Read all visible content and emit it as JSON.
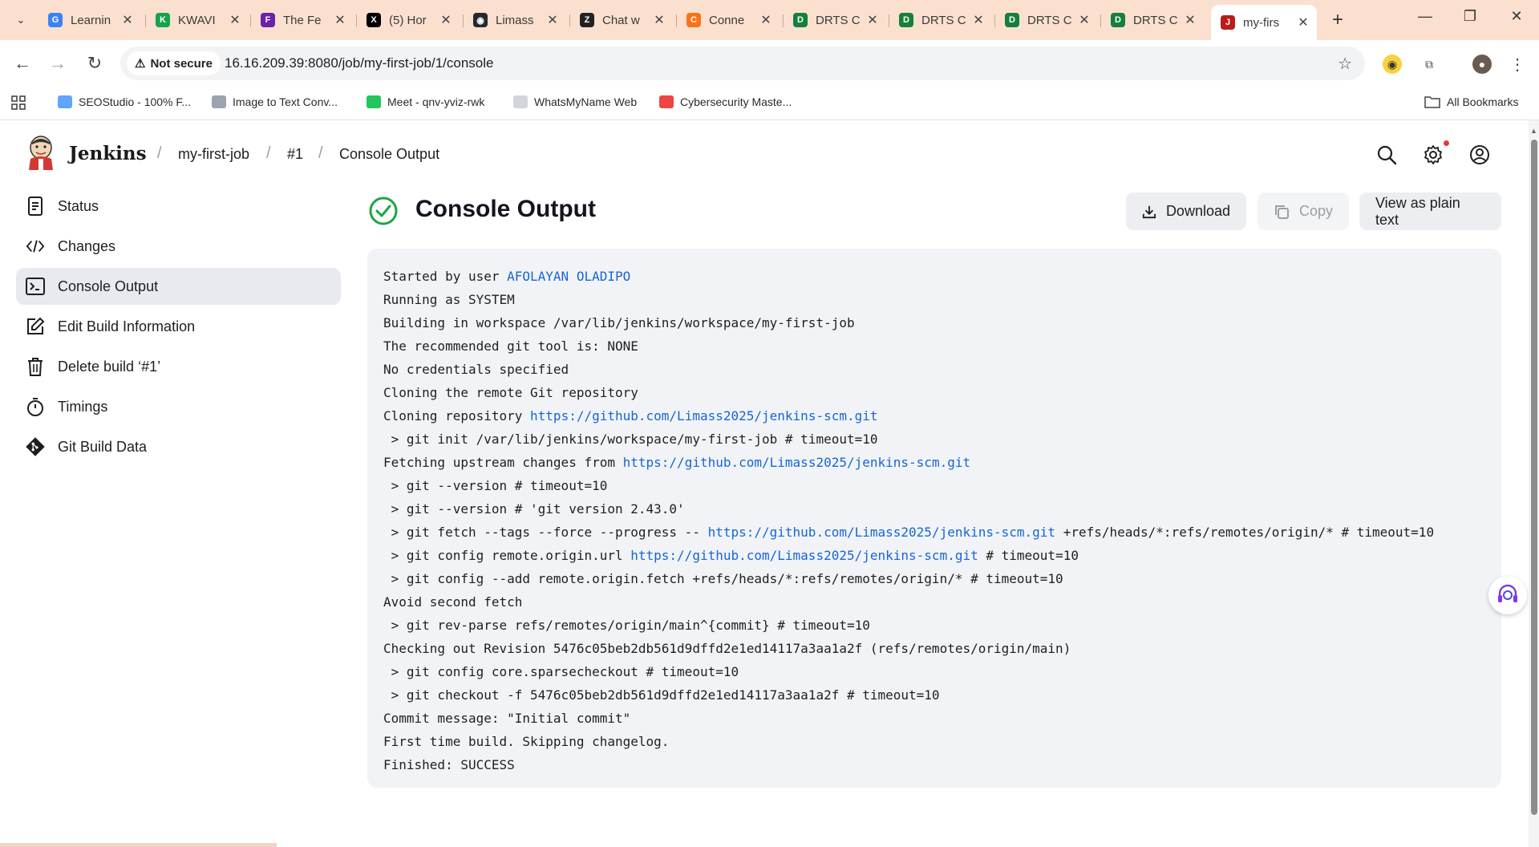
{
  "browser": {
    "tabs": [
      {
        "title": "Learnin",
        "fav_color": "#3b82f6",
        "fav_glyph": "G"
      },
      {
        "title": "KWAVI",
        "fav_color": "#16a34a",
        "fav_glyph": "K"
      },
      {
        "title": "The Fe",
        "fav_color": "#6b21a8",
        "fav_glyph": "F"
      },
      {
        "title": "(5) Hor",
        "fav_color": "#000000",
        "fav_glyph": "X"
      },
      {
        "title": "Limass",
        "fav_color": "#24292f",
        "fav_glyph": "◉"
      },
      {
        "title": "Chat w",
        "fav_color": "#222222",
        "fav_glyph": "Z"
      },
      {
        "title": "Conne",
        "fav_color": "#f97316",
        "fav_glyph": "C"
      },
      {
        "title": "DRTS C",
        "fav_color": "#15803d",
        "fav_glyph": "D"
      },
      {
        "title": "DRTS C",
        "fav_color": "#15803d",
        "fav_glyph": "D"
      },
      {
        "title": "DRTS C",
        "fav_color": "#15803d",
        "fav_glyph": "D"
      },
      {
        "title": "DRTS C",
        "fav_color": "#15803d",
        "fav_glyph": "D"
      },
      {
        "title": "my-firs",
        "fav_color": "#b91c1c",
        "fav_glyph": "J",
        "active": true
      }
    ],
    "security_label": "Not secure",
    "url": "16.16.209.39:8080/job/my-first-job/1/console",
    "bookmarks": [
      "SEOStudio - 100% F...",
      "Image to Text Conv...",
      "Meet - qnv-yviz-rwk",
      "WhatsMyName Web",
      "Cybersecurity Maste..."
    ],
    "all_bookmarks": "All Bookmarks"
  },
  "jenkins": {
    "brand": "Jenkins",
    "breadcrumbs": [
      "my-first-job",
      "#1",
      "Console Output"
    ]
  },
  "sidebar": {
    "items": [
      {
        "label": "Status",
        "icon": "document-icon"
      },
      {
        "label": "Changes",
        "icon": "code-icon"
      },
      {
        "label": "Console Output",
        "icon": "terminal-icon",
        "active": true
      },
      {
        "label": "Edit Build Information",
        "icon": "edit-icon"
      },
      {
        "label": "Delete build ‘#1’",
        "icon": "trash-icon"
      },
      {
        "label": "Timings",
        "icon": "stopwatch-icon"
      },
      {
        "label": "Git Build Data",
        "icon": "git-icon"
      }
    ]
  },
  "main": {
    "title": "Console Output",
    "status_color": "#1ea446",
    "buttons": {
      "download": "Download",
      "copy": "Copy",
      "plain": "View as plain text"
    }
  },
  "console": {
    "lines": [
      {
        "pre": "Started by user ",
        "link": "AFOLAYAN OLADIPO",
        "post": ""
      },
      {
        "pre": "Running as SYSTEM",
        "link": "",
        "post": ""
      },
      {
        "pre": "Building in workspace /var/lib/jenkins/workspace/my-first-job",
        "link": "",
        "post": ""
      },
      {
        "pre": "The recommended git tool is: NONE",
        "link": "",
        "post": ""
      },
      {
        "pre": "No credentials specified",
        "link": "",
        "post": ""
      },
      {
        "pre": "Cloning the remote Git repository",
        "link": "",
        "post": ""
      },
      {
        "pre": "Cloning repository ",
        "link": "https://github.com/Limass2025/jenkins-scm.git",
        "post": ""
      },
      {
        "pre": " > git init /var/lib/jenkins/workspace/my-first-job # timeout=10",
        "link": "",
        "post": ""
      },
      {
        "pre": "Fetching upstream changes from ",
        "link": "https://github.com/Limass2025/jenkins-scm.git",
        "post": ""
      },
      {
        "pre": " > git --version # timeout=10",
        "link": "",
        "post": ""
      },
      {
        "pre": " > git --version # 'git version 2.43.0'",
        "link": "",
        "post": ""
      },
      {
        "pre": " > git fetch --tags --force --progress -- ",
        "link": "https://github.com/Limass2025/jenkins-scm.git",
        "post": " +refs/heads/*:refs/remotes/origin/* # timeout=10"
      },
      {
        "pre": " > git config remote.origin.url ",
        "link": "https://github.com/Limass2025/jenkins-scm.git",
        "post": " # timeout=10"
      },
      {
        "pre": " > git config --add remote.origin.fetch +refs/heads/*:refs/remotes/origin/* # timeout=10",
        "link": "",
        "post": ""
      },
      {
        "pre": "Avoid second fetch",
        "link": "",
        "post": ""
      },
      {
        "pre": " > git rev-parse refs/remotes/origin/main^{commit} # timeout=10",
        "link": "",
        "post": ""
      },
      {
        "pre": "Checking out Revision 5476c05beb2db561d9dffd2e1ed14117a3aa1a2f (refs/remotes/origin/main)",
        "link": "",
        "post": ""
      },
      {
        "pre": " > git config core.sparsecheckout # timeout=10",
        "link": "",
        "post": ""
      },
      {
        "pre": " > git checkout -f 5476c05beb2db561d9dffd2e1ed14117a3aa1a2f # timeout=10",
        "link": "",
        "post": ""
      },
      {
        "pre": "Commit message: \"Initial commit\"",
        "link": "",
        "post": ""
      },
      {
        "pre": "First time build. Skipping changelog.",
        "link": "",
        "post": ""
      },
      {
        "pre": "Finished: SUCCESS",
        "link": "",
        "post": ""
      }
    ]
  }
}
